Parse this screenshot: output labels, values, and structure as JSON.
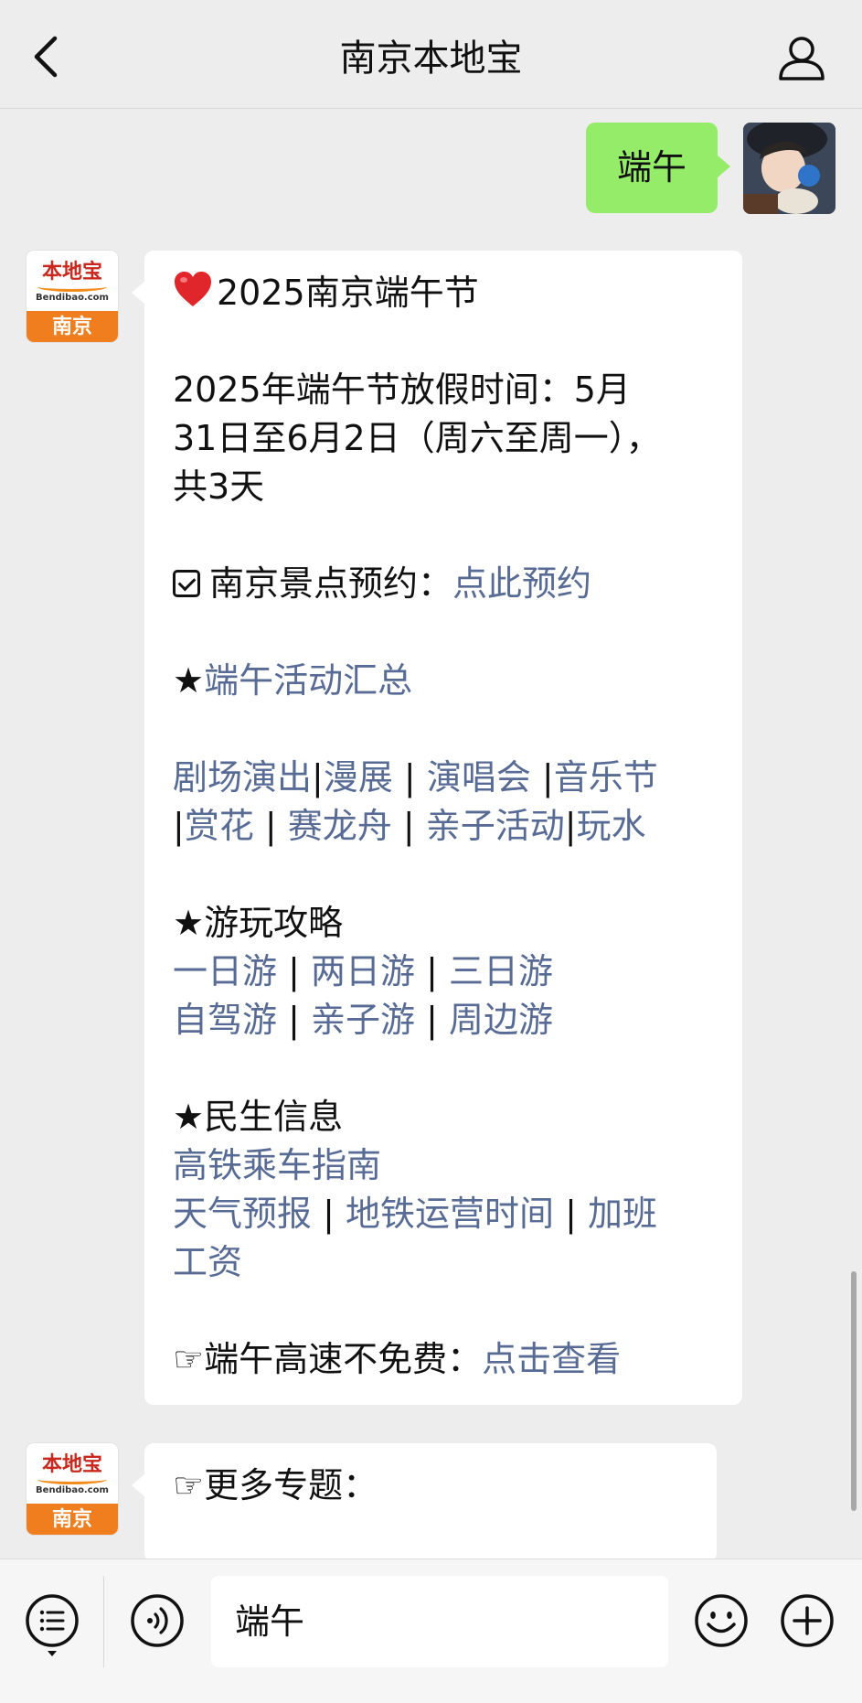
{
  "header": {
    "title": "南京本地宝"
  },
  "outgoing": {
    "text": "端午"
  },
  "bot": {
    "avatar_brand": "本地宝",
    "avatar_domain": "Bendibao.com",
    "avatar_city": "南京"
  },
  "message1": {
    "title": "2025南京端午节",
    "holiday_line1": "2025年端午节放假时间：5月",
    "holiday_line2": "31日至6月2日（周六至周一），",
    "holiday_line3": "共3天",
    "booking_label": "南京景点预约：",
    "booking_link": "点此预约",
    "activities_star": "★",
    "activities_link": "端午活动汇总",
    "activity_links": [
      "剧场演出",
      "漫展",
      "演唱会",
      "音乐节",
      "赏花",
      "赛龙舟",
      "亲子活动",
      "玩水"
    ],
    "guide_heading": "★游玩攻略",
    "guide_links": [
      "一日游",
      "两日游",
      "三日游",
      "自驾游",
      "亲子游",
      "周边游"
    ],
    "info_heading": "★民生信息",
    "info_links": [
      "高铁乘车指南",
      "天气预报",
      "地铁运营时间",
      "加班",
      "工资"
    ],
    "highway_label": "☞端午高速不免费：",
    "highway_link": "点击查看"
  },
  "message2": {
    "text": "☞更多专题："
  },
  "input": {
    "value": "端午"
  },
  "colors": {
    "background": "#ededed",
    "outgoing_bubble": "#95ec69",
    "link": "#576b95",
    "avatar_orange": "#f07d1e"
  },
  "icons": [
    "back-chevron-icon",
    "user-profile-icon",
    "heart-icon",
    "checkbox-icon",
    "menu-list-icon",
    "voice-icon",
    "emoji-icon",
    "plus-icon"
  ]
}
